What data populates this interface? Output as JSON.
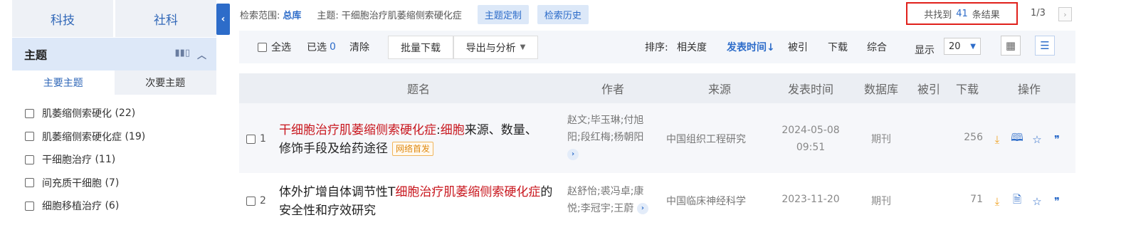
{
  "sidebar": {
    "cat_tabs": [
      "科技",
      "社科"
    ],
    "facet_title": "主题",
    "sub_tabs": [
      "主要主题",
      "次要主题"
    ],
    "items": [
      {
        "label": "肌萎缩侧索硬化",
        "count": "(22)"
      },
      {
        "label": "肌萎缩侧索硬化症",
        "count": "(19)"
      },
      {
        "label": "干细胞治疗",
        "count": "(11)"
      },
      {
        "label": "间充质干细胞",
        "count": "(7)"
      },
      {
        "label": "细胞移植治疗",
        "count": "(6)"
      }
    ]
  },
  "topbar": {
    "scope_label": "检索范围:",
    "scope_value": "总库",
    "topic_label": "主题:",
    "topic_value": "干细胞治疗肌萎缩侧索硬化症",
    "btn_custom": "主题定制",
    "btn_history": "检索历史",
    "result_prefix": "共找到",
    "result_count": "41",
    "result_suffix": "条结果",
    "pager": "1/3"
  },
  "toolbar": {
    "select_all": "全选",
    "selected_label": "已选",
    "selected_count": "0",
    "clear": "清除",
    "batch_download": "批量下载",
    "export": "导出与分析",
    "sort_label": "排序:",
    "sort_relevance": "相关度",
    "sort_date": "发表时间↓",
    "sort_cited": "被引",
    "sort_download": "下载",
    "sort_comprehensive": "综合",
    "display_label": "显示",
    "display_value": "20"
  },
  "table": {
    "headers": {
      "title": "题名",
      "author": "作者",
      "source": "来源",
      "date": "发表时间",
      "db": "数据库",
      "cited": "被引",
      "download": "下载",
      "ops": "操作"
    },
    "rows": [
      {
        "index": "1",
        "title_hl1": "干细胞治疗肌萎缩侧索硬化症",
        "title_sep": ":",
        "title_hl2": "细胞",
        "title_rest": "来源、数量、修饰手段及给药途径",
        "badge": "网络首发",
        "authors": "赵文;毕玉琳;付旭阳;段红梅;杨朝阳",
        "source": "中国组织工程研究",
        "date_line1": "2024-05-08",
        "date_line2": "09:51",
        "db": "期刊",
        "cited": "",
        "downloads": "256"
      },
      {
        "index": "2",
        "title_pre": "体外扩增自体调节性T",
        "title_hl": "细胞治疗肌萎缩侧索硬化症",
        "title_rest": "的安全性和疗效研究",
        "authors": "赵舒怡;裘冯卓;康悦;李冠宇;王蔚",
        "source": "中国临床神经科学",
        "date": "2023-11-20",
        "db": "期刊",
        "cited": "",
        "downloads": "71"
      }
    ]
  }
}
